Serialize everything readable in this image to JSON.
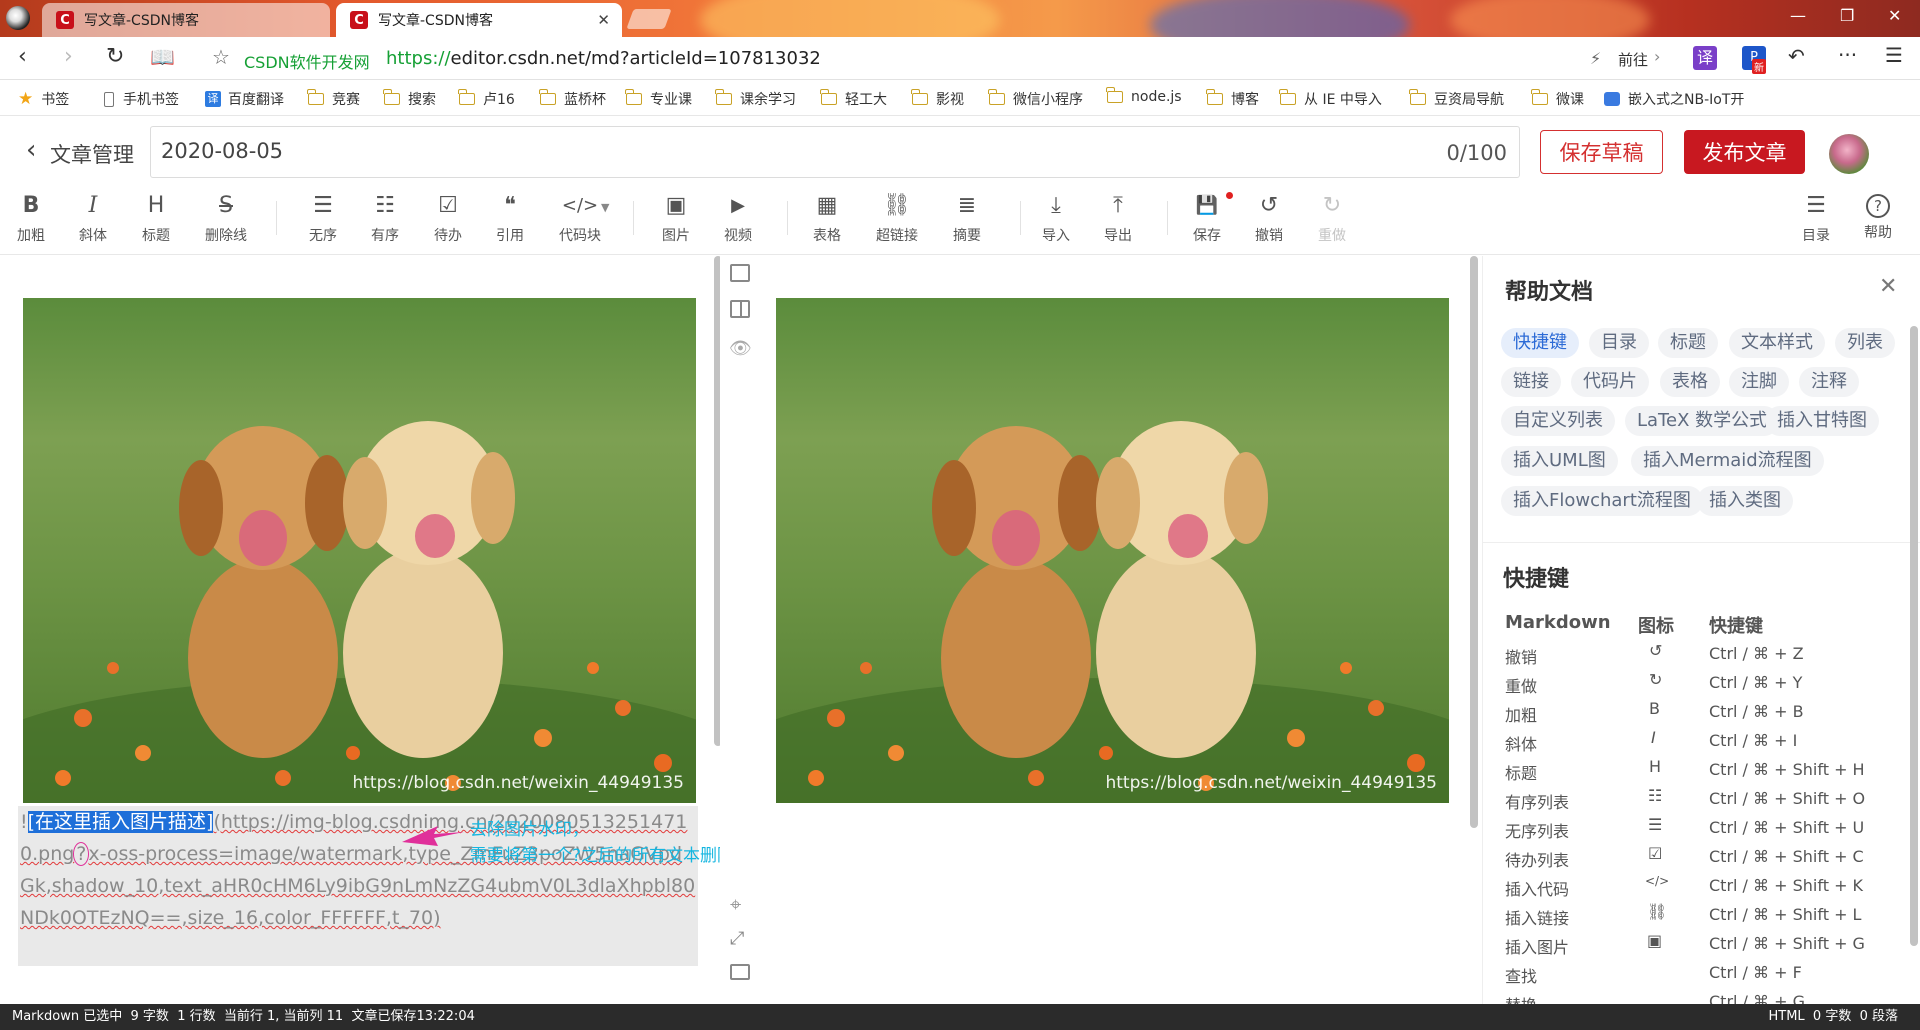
{
  "browser": {
    "tabs": [
      {
        "title": "写文章-CSDN博客",
        "active": false
      },
      {
        "title": "写文章-CSDN博客",
        "active": true
      }
    ],
    "site_label": "CSDN软件开发网",
    "url_scheme": "https://",
    "url_rest": "editor.csdn.net/md?articleId=107813032",
    "forward_label": "前往",
    "translate_badge": "译",
    "new_badge": "新"
  },
  "bookmarks": [
    "书签",
    "手机书签",
    "百度翻译",
    "竞赛",
    "搜索",
    "卢16",
    "蓝桥杯",
    "专业课",
    "课余学习",
    "轻工大",
    "影视",
    "微信小程序",
    "node.js",
    "博客",
    "从 IE 中导入",
    "豆资局导航",
    "微课",
    "嵌入式之NB-IoT开"
  ],
  "editor_header": {
    "back_label": "文章管理",
    "title_value": "2020-08-05",
    "char_count": "0/100",
    "save_draft": "保存草稿",
    "publish": "发布文章"
  },
  "toolbar": [
    {
      "icon": "B",
      "label": "加粗"
    },
    {
      "icon": "I",
      "label": "斜体"
    },
    {
      "icon": "H",
      "label": "标题"
    },
    {
      "icon": "S",
      "label": "删除线"
    },
    {
      "icon": "☰",
      "label": "无序"
    },
    {
      "icon": "☷",
      "label": "有序"
    },
    {
      "icon": "☑",
      "label": "待办"
    },
    {
      "icon": "❝",
      "label": "引用"
    },
    {
      "icon": "</>",
      "label": "代码块"
    },
    {
      "icon": "▣",
      "label": "图片"
    },
    {
      "icon": "▶",
      "label": "视频"
    },
    {
      "icon": "▦",
      "label": "表格"
    },
    {
      "icon": "⛓",
      "label": "超链接"
    },
    {
      "icon": "≣",
      "label": "摘要"
    },
    {
      "icon": "⤓",
      "label": "导入"
    },
    {
      "icon": "⤒",
      "label": "导出"
    },
    {
      "icon": "💾",
      "label": "保存"
    },
    {
      "icon": "↺",
      "label": "撤销"
    },
    {
      "icon": "↻",
      "label": "重做"
    },
    {
      "icon": "☰",
      "label": "目录"
    },
    {
      "icon": "?",
      "label": "帮助"
    }
  ],
  "watermark": "https://blog.csdn.net/weixin_44949135",
  "markdown": {
    "bang": "!",
    "selected": "[在这里插入图片描述]",
    "url_part1": "(https://img-blog.csdnimg.cn/20200805132514710.png",
    "question": "?",
    "url_part2": "x-oss-process=image/watermark,type_ZmFuZ3poZW5naGVpdGk,shadow_10,text_aHR0cHM6Ly9ibG9nLmNzZG4ubmV0L3dlaXhpbl80NDk0OTEzNQ==,size_16,color_FFFFFF,t_70)"
  },
  "annotation": {
    "line1": "去除图片水印，",
    "line2": "需要将第一个?之后的所有文本删除！"
  },
  "help": {
    "title": "帮助文档",
    "chips": [
      "快捷键",
      "目录",
      "标题",
      "文本样式",
      "列表",
      "链接",
      "代码片",
      "表格",
      "注脚",
      "注释",
      "自定义列表",
      "LaTeX 数学公式",
      "插入甘特图",
      "插入UML图",
      "插入Mermaid流程图",
      "插入Flowchart流程图",
      "插入类图"
    ],
    "section_title": "快捷键",
    "headers": [
      "Markdown",
      "图标",
      "快捷键"
    ],
    "rows": [
      {
        "name": "撤销",
        "icon": "↺",
        "keys": "Ctrl / ⌘ + Z"
      },
      {
        "name": "重做",
        "icon": "↻",
        "keys": "Ctrl / ⌘ + Y"
      },
      {
        "name": "加粗",
        "icon": "B",
        "keys": "Ctrl / ⌘ + B"
      },
      {
        "name": "斜体",
        "icon": "I",
        "keys": "Ctrl / ⌘ + I"
      },
      {
        "name": "标题",
        "icon": "H",
        "keys": "Ctrl / ⌘ + Shift + H"
      },
      {
        "name": "有序列表",
        "icon": "☷",
        "keys": "Ctrl / ⌘ + Shift + O"
      },
      {
        "name": "无序列表",
        "icon": "☰",
        "keys": "Ctrl / ⌘ + Shift + U"
      },
      {
        "name": "待办列表",
        "icon": "☑",
        "keys": "Ctrl / ⌘ + Shift + C"
      },
      {
        "name": "插入代码",
        "icon": "</>",
        "keys": "Ctrl / ⌘ + Shift + K"
      },
      {
        "name": "插入链接",
        "icon": "⛓",
        "keys": "Ctrl / ⌘ + Shift + L"
      },
      {
        "name": "插入图片",
        "icon": "▣",
        "keys": "Ctrl / ⌘ + Shift + G"
      },
      {
        "name": "查找",
        "icon": "",
        "keys": "Ctrl / ⌘ + F"
      },
      {
        "name": "替换",
        "icon": "",
        "keys": "Ctrl / ⌘ + G"
      }
    ]
  },
  "status": {
    "left": "Markdown 已选中  9 字数  1 行数  当前行 1, 当前列 11  文章已保存13:22:04",
    "right": "HTML  0 字数  0 段落"
  },
  "colors": {
    "brand_red": "#c81820",
    "link_green": "#16a035",
    "accent_blue": "#2d6bd6",
    "annotation_cyan": "#15b6e0",
    "annotation_magenta": "#e0309a"
  }
}
